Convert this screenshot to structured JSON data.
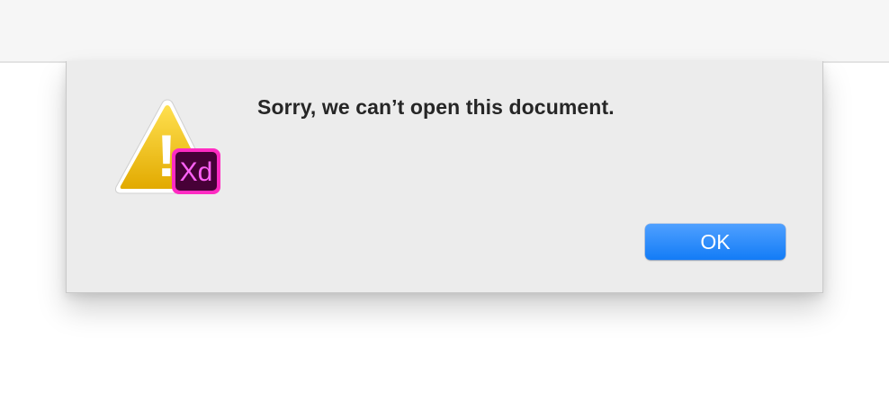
{
  "dialog": {
    "message": "Sorry, we can’t open this document.",
    "ok_label": "OK",
    "icon": {
      "name": "warning-xd-icon",
      "badge_text": "Xd",
      "warning_mark": "!"
    }
  },
  "colors": {
    "accent": "#137cf6",
    "warning": "#f2c20d",
    "badge_bg": "#470137",
    "badge_border": "#ff2bc2",
    "badge_text": "#ff61f6"
  }
}
